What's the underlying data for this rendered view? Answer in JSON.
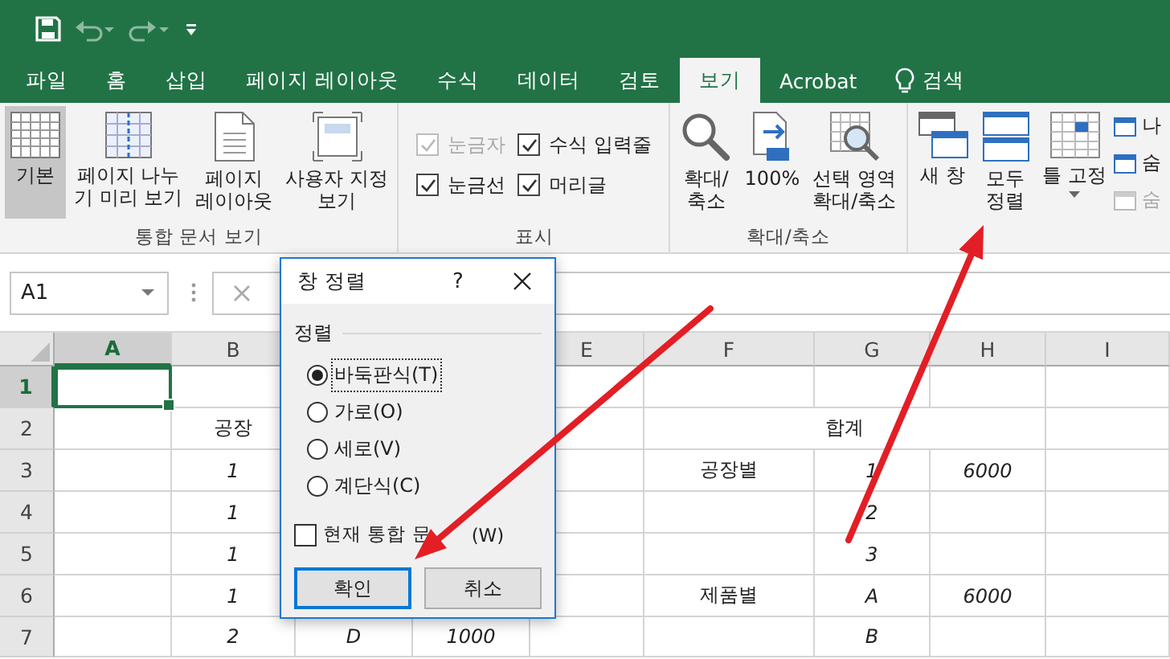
{
  "tabs": [
    {
      "label": "파일",
      "selected": false
    },
    {
      "label": "홈",
      "selected": false
    },
    {
      "label": "삽입",
      "selected": false
    },
    {
      "label": "페이지 레이아웃",
      "selected": false
    },
    {
      "label": "수식",
      "selected": false
    },
    {
      "label": "데이터",
      "selected": false
    },
    {
      "label": "검토",
      "selected": false
    },
    {
      "label": "보기",
      "selected": true
    },
    {
      "label": "Acrobat",
      "selected": false
    }
  ],
  "tell_me": {
    "label": "검색"
  },
  "ribbon": {
    "groups": [
      {
        "label": "통합 문서 보기",
        "items": [
          {
            "kind": "large",
            "label": "기본",
            "selected": true
          },
          {
            "kind": "large",
            "label": "페이지 나누\n기 미리 보기",
            "selected": false
          },
          {
            "kind": "large",
            "label": "페이지\n레이아웃",
            "selected": false
          },
          {
            "kind": "large",
            "label": "사용자 지정\n보기",
            "selected": false
          }
        ]
      },
      {
        "label": "표시",
        "items": [
          {
            "kind": "check",
            "label": "눈금자",
            "checked": true,
            "disabled": true
          },
          {
            "kind": "check",
            "label": "수식 입력줄",
            "checked": true,
            "disabled": false
          },
          {
            "kind": "check",
            "label": "눈금선",
            "checked": true,
            "disabled": false
          },
          {
            "kind": "check",
            "label": "머리글",
            "checked": true,
            "disabled": false
          }
        ]
      },
      {
        "label": "확대/축소",
        "items": [
          {
            "kind": "large",
            "label": "확대/\n축소"
          },
          {
            "kind": "large",
            "label": "100%"
          },
          {
            "kind": "large",
            "label": "선택 영역\n확대/축소"
          }
        ]
      },
      {
        "items": [
          {
            "kind": "large",
            "label": "새 창"
          },
          {
            "kind": "large",
            "label": "모두\n정렬"
          },
          {
            "kind": "dropdown",
            "label": "틀 고정"
          },
          {
            "kind": "stack",
            "entries": [
              {
                "label": "나",
                "disabled": false
              },
              {
                "label": "숨",
                "disabled": false
              },
              {
                "label": "숨",
                "disabled": true
              }
            ]
          }
        ]
      }
    ]
  },
  "name_box": {
    "value": "A1"
  },
  "sheet": {
    "columns": [
      {
        "label": "A",
        "selected": true
      },
      {
        "label": "B",
        "selected": false
      },
      null,
      null,
      {
        "label": "E",
        "selected": false
      },
      {
        "label": "F",
        "selected": false
      },
      {
        "label": "G",
        "selected": false
      },
      {
        "label": "H",
        "selected": false
      },
      {
        "label": "I",
        "selected": false
      }
    ],
    "rows": [
      {
        "label": "1",
        "selected": true,
        "cells": [
          {
            "selected": true
          },
          null,
          null,
          null,
          null,
          null,
          null,
          null,
          null
        ]
      },
      {
        "label": "2",
        "selected": false,
        "cells": [
          null,
          {
            "text": "공장",
            "italic": false,
            "selected": false
          },
          null,
          null,
          null,
          {
            "text": "합계",
            "italic": false,
            "selected": false
          },
          {
            "joined": true
          },
          {
            "joined": true
          },
          null
        ]
      },
      {
        "label": "3",
        "selected": false,
        "cells": [
          null,
          {
            "text": "1",
            "italic": true,
            "selected": false
          },
          null,
          null,
          null,
          {
            "text": "공장별",
            "italic": false,
            "selected": false
          },
          {
            "text": "1",
            "italic": true,
            "selected": false
          },
          {
            "text": "6000",
            "italic": true,
            "selected": false
          },
          null
        ]
      },
      {
        "label": "4",
        "selected": false,
        "cells": [
          null,
          {
            "text": "1",
            "italic": true,
            "selected": false
          },
          null,
          null,
          null,
          null,
          {
            "text": "2",
            "italic": true,
            "selected": false
          },
          null,
          null
        ]
      },
      {
        "label": "5",
        "selected": false,
        "cells": [
          null,
          {
            "text": "1",
            "italic": true,
            "selected": false
          },
          null,
          null,
          null,
          null,
          {
            "text": "3",
            "italic": true,
            "selected": false
          },
          null,
          null
        ]
      },
      {
        "label": "6",
        "selected": false,
        "cells": [
          null,
          {
            "text": "1",
            "italic": true,
            "selected": false
          },
          null,
          null,
          null,
          {
            "text": "제품별",
            "italic": false,
            "selected": false
          },
          {
            "text": "A",
            "italic": true,
            "selected": false
          },
          {
            "text": "6000",
            "italic": true,
            "selected": false
          },
          null
        ]
      },
      {
        "label": "7",
        "selected": false,
        "cells": [
          null,
          {
            "text": "2",
            "italic": true,
            "selected": false
          },
          {
            "text": "D",
            "italic": true,
            "selected": false
          },
          {
            "text": "1000",
            "italic": true,
            "selected": false
          },
          null,
          null,
          {
            "text": "B",
            "italic": true,
            "selected": false
          },
          null,
          null
        ]
      }
    ]
  },
  "dialog": {
    "title": "창 정렬",
    "help": "?",
    "group": "정렬",
    "options": [
      {
        "label": "바둑판식(T)",
        "selected": true
      },
      {
        "label": "가로(O)",
        "selected": false
      },
      {
        "label": "세로(V)",
        "selected": false
      },
      {
        "label": "계단식(C)",
        "selected": false
      }
    ],
    "checkbox": {
      "label": "현재 통합 문",
      "label_end": "(W)",
      "checked": false
    },
    "buttons": [
      {
        "label": "확인",
        "default": true
      },
      {
        "label": "취소",
        "default": false
      }
    ]
  }
}
